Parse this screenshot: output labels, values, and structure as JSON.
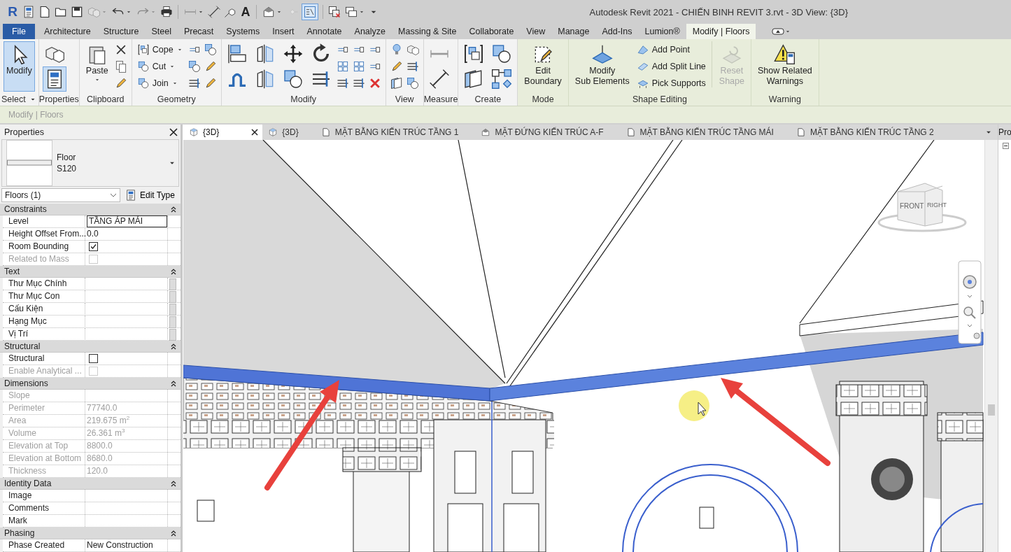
{
  "window": {
    "title": "Autodesk Revit 2021 - CHIẾN BINH REVIT 3.rvt - 3D View: {3D}"
  },
  "quick_access": [
    {
      "kind": "logo",
      "label": "R"
    },
    {
      "kind": "icon",
      "disabled": false,
      "menu": false
    },
    {
      "kind": "icon",
      "disabled": false,
      "menu": false
    },
    {
      "kind": "icon",
      "disabled": false,
      "menu": false
    },
    {
      "kind": "icon",
      "disabled": false,
      "menu": false
    },
    {
      "kind": "icon",
      "disabled": true,
      "menu": true
    },
    {
      "kind": "icon",
      "disabled": false,
      "menu": true
    },
    {
      "kind": "icon",
      "disabled": true,
      "menu": true
    },
    {
      "kind": "icon",
      "disabled": false,
      "menu": false
    },
    {
      "kind": "separator"
    },
    {
      "kind": "icon",
      "disabled": false,
      "menu": true
    },
    {
      "kind": "icon",
      "disabled": false,
      "menu": false
    },
    {
      "kind": "icon",
      "disabled": false,
      "menu": false
    },
    {
      "kind": "glyph",
      "label": "A"
    },
    {
      "kind": "separator"
    },
    {
      "kind": "icon",
      "disabled": false,
      "menu": true
    },
    {
      "kind": "icon",
      "disabled": true,
      "menu": false
    },
    {
      "kind": "toggle",
      "selected": true
    },
    {
      "kind": "separator"
    },
    {
      "kind": "icon",
      "disabled": false,
      "menu": false
    },
    {
      "kind": "icon",
      "disabled": false,
      "menu": true
    },
    {
      "kind": "customize"
    }
  ],
  "ribbon_tabs": [
    {
      "label": "File",
      "kind": "file",
      "selected": false
    },
    {
      "label": "Architecture",
      "kind": "tab",
      "selected": false
    },
    {
      "label": "Structure",
      "kind": "tab",
      "selected": false
    },
    {
      "label": "Steel",
      "kind": "tab",
      "selected": false
    },
    {
      "label": "Precast",
      "kind": "tab",
      "selected": false
    },
    {
      "label": "Systems",
      "kind": "tab",
      "selected": false
    },
    {
      "label": "Insert",
      "kind": "tab",
      "selected": false
    },
    {
      "label": "Annotate",
      "kind": "tab",
      "selected": false
    },
    {
      "label": "Analyze",
      "kind": "tab",
      "selected": false
    },
    {
      "label": "Massing & Site",
      "kind": "tab",
      "selected": false
    },
    {
      "label": "Collaborate",
      "kind": "tab",
      "selected": false
    },
    {
      "label": "View",
      "kind": "tab",
      "selected": false
    },
    {
      "label": "Manage",
      "kind": "tab",
      "selected": false
    },
    {
      "label": "Add-Ins",
      "kind": "tab",
      "selected": false
    },
    {
      "label": "Lumion®",
      "kind": "tab",
      "selected": false
    },
    {
      "label": "Modify | Floors",
      "kind": "contextual",
      "selected": true
    }
  ],
  "ribbon_panels": [
    {
      "title": "Select",
      "menu": true,
      "contextual": false,
      "items": [
        {
          "kind": "large",
          "label_lines": [
            "Modify"
          ],
          "selected": true,
          "disabled": false,
          "menu": false
        }
      ]
    },
    {
      "title": "Properties",
      "menu": false,
      "contextual": false,
      "items": [
        {
          "kind": "tool",
          "selected": false
        },
        {
          "kind": "tool",
          "selected": true
        }
      ]
    },
    {
      "title": "Clipboard",
      "menu": false,
      "contextual": false,
      "items": [
        {
          "kind": "large",
          "label_lines": [
            "Paste"
          ],
          "selected": false,
          "disabled": false,
          "menu": true
        },
        {
          "kind": "icon"
        },
        {
          "kind": "icon"
        },
        {
          "kind": "icon"
        }
      ]
    },
    {
      "title": "Geometry",
      "menu": false,
      "contextual": false,
      "items": [
        {
          "kind": "small",
          "label": "Cope",
          "menu": true
        },
        {
          "kind": "small",
          "label": "Cut",
          "menu": true
        },
        {
          "kind": "small",
          "label": "Join",
          "menu": true
        },
        {
          "kind": "icon"
        },
        {
          "kind": "icon"
        },
        {
          "kind": "icon"
        },
        {
          "kind": "icon"
        },
        {
          "kind": "icon"
        },
        {
          "kind": "icon"
        }
      ]
    },
    {
      "title": "Modify",
      "menu": false,
      "contextual": false,
      "items": [
        {
          "kind": "tool",
          "selected": false
        },
        {
          "kind": "tool",
          "selected": false
        },
        {
          "kind": "tool",
          "selected": false
        },
        {
          "kind": "tool",
          "selected": false
        },
        {
          "kind": "tool",
          "selected": false
        },
        {
          "kind": "tool",
          "selected": false
        },
        {
          "kind": "tool",
          "selected": false
        },
        {
          "kind": "tool",
          "selected": false
        },
        {
          "kind": "icon"
        },
        {
          "kind": "icon"
        },
        {
          "kind": "icon"
        },
        {
          "kind": "icon"
        },
        {
          "kind": "icon"
        },
        {
          "kind": "icon"
        },
        {
          "kind": "icon"
        },
        {
          "kind": "icon"
        },
        {
          "kind": "icon"
        }
      ]
    },
    {
      "title": "View",
      "menu": false,
      "contextual": false,
      "items": [
        {
          "kind": "icon"
        },
        {
          "kind": "icon"
        },
        {
          "kind": "icon"
        },
        {
          "kind": "icon"
        },
        {
          "kind": "icon"
        },
        {
          "kind": "icon"
        }
      ]
    },
    {
      "title": "Measure",
      "menu": false,
      "contextual": false,
      "items": [
        {
          "kind": "tool",
          "selected": false
        },
        {
          "kind": "tool",
          "selected": false
        }
      ]
    },
    {
      "title": "Create",
      "menu": false,
      "contextual": false,
      "items": [
        {
          "kind": "tool",
          "selected": false
        },
        {
          "kind": "tool",
          "selected": false
        },
        {
          "kind": "tool",
          "selected": false
        },
        {
          "kind": "tool",
          "selected": false
        }
      ]
    },
    {
      "title": "Mode",
      "menu": false,
      "contextual": true,
      "items": [
        {
          "kind": "large",
          "label_lines": [
            "Edit",
            "Boundary"
          ],
          "selected": false,
          "disabled": false,
          "menu": false
        }
      ]
    },
    {
      "title": "Shape Editing",
      "menu": false,
      "contextual": true,
      "items": [
        {
          "kind": "large",
          "label_lines": [
            "Modify",
            "Sub Elements"
          ],
          "selected": false,
          "disabled": false,
          "menu": false
        },
        {
          "kind": "small",
          "label": "Add Point",
          "menu": false
        },
        {
          "kind": "small",
          "label": "Add Split Line",
          "menu": false
        },
        {
          "kind": "small",
          "label": "Pick Supports",
          "menu": false
        },
        {
          "kind": "separator"
        },
        {
          "kind": "large",
          "label_lines": [
            "Reset",
            "Shape"
          ],
          "selected": false,
          "disabled": true,
          "menu": false
        }
      ]
    },
    {
      "title": "Warning",
      "menu": false,
      "contextual": true,
      "items": [
        {
          "kind": "large",
          "label_lines": [
            "Show Related",
            "Warnings"
          ],
          "selected": false,
          "disabled": false,
          "menu": false
        }
      ]
    }
  ],
  "options_bar": {
    "context": "Modify | Floors"
  },
  "properties": {
    "title": "Properties",
    "type_family": "Floor",
    "type_name": "S120",
    "filter": "Floors (1)",
    "edit_type": "Edit Type",
    "groups": [
      {
        "name": "Constraints",
        "rows": [
          {
            "label": "Level",
            "value": "TẦNG ÁP MÁI",
            "kind": "input",
            "disabled": false
          },
          {
            "label": "Height Offset From...",
            "value": "0.0",
            "kind": "text",
            "disabled": false
          },
          {
            "label": "Room Bounding",
            "kind": "check",
            "checked": true,
            "disabled": false
          },
          {
            "label": "Related to Mass",
            "kind": "check",
            "checked": false,
            "disabled": true
          }
        ]
      },
      {
        "name": "Text",
        "rows": [
          {
            "label": "Thư Mục Chính",
            "kind": "picker",
            "disabled": false
          },
          {
            "label": "Thư Mục Con",
            "kind": "picker",
            "disabled": false
          },
          {
            "label": "Cấu Kiện",
            "kind": "picker",
            "disabled": false
          },
          {
            "label": "Hạng Mục",
            "kind": "picker",
            "disabled": false
          },
          {
            "label": "Vị Trí",
            "kind": "picker",
            "disabled": false
          }
        ]
      },
      {
        "name": "Structural",
        "rows": [
          {
            "label": "Structural",
            "kind": "check",
            "checked": false,
            "disabled": false
          },
          {
            "label": "Enable Analytical ...",
            "kind": "check",
            "checked": false,
            "disabled": true
          }
        ]
      },
      {
        "name": "Dimensions",
        "rows": [
          {
            "label": "Slope",
            "kind": "text",
            "disabled": true
          },
          {
            "label": "Perimeter",
            "value": "77740.0",
            "kind": "text",
            "disabled": true
          },
          {
            "label": "Area",
            "value": "219.675 m$^{2}$",
            "kind": "text",
            "disabled": true
          },
          {
            "label": "Volume",
            "value": "26.361 m$^{3}$",
            "kind": "text",
            "disabled": true
          },
          {
            "label": "Elevation at Top",
            "value": "8800.0",
            "kind": "text",
            "disabled": true
          },
          {
            "label": "Elevation at Bottom",
            "value": "8680.0",
            "kind": "text",
            "disabled": true
          },
          {
            "label": "Thickness",
            "value": "120.0",
            "kind": "text",
            "disabled": true
          }
        ]
      },
      {
        "name": "Identity Data",
        "rows": [
          {
            "label": "Image",
            "kind": "text",
            "disabled": false
          },
          {
            "label": "Comments",
            "kind": "text",
            "disabled": false
          },
          {
            "label": "Mark",
            "kind": "text",
            "disabled": false
          }
        ]
      },
      {
        "name": "Phasing",
        "rows": [
          {
            "label": "Phase Created",
            "value": "New Construction",
            "kind": "text",
            "disabled": false
          }
        ]
      }
    ]
  },
  "view_tabs": [
    {
      "label": "{3D}",
      "kind": "model",
      "selected": true
    },
    {
      "label": "{3D}",
      "kind": "model",
      "selected": false
    },
    {
      "label": "MẶT BẰNG KIẾN TRÚC TẦNG 1",
      "kind": "plan",
      "selected": false
    },
    {
      "label": "MẶT ĐỨNG KIẾN TRÚC A-F",
      "kind": "elevation",
      "selected": false
    },
    {
      "label": "MẶT BẰNG KIẾN TRÚC TẦNG MÁI",
      "kind": "plan",
      "selected": false
    },
    {
      "label": "MẶT BẰNG KIẾN TRÚC TẦNG 2",
      "kind": "plan",
      "selected": false
    }
  ],
  "viewcube": {
    "faces": [
      "FRONT",
      "RIGHT"
    ]
  },
  "project_browser": {
    "title": "Pro"
  }
}
